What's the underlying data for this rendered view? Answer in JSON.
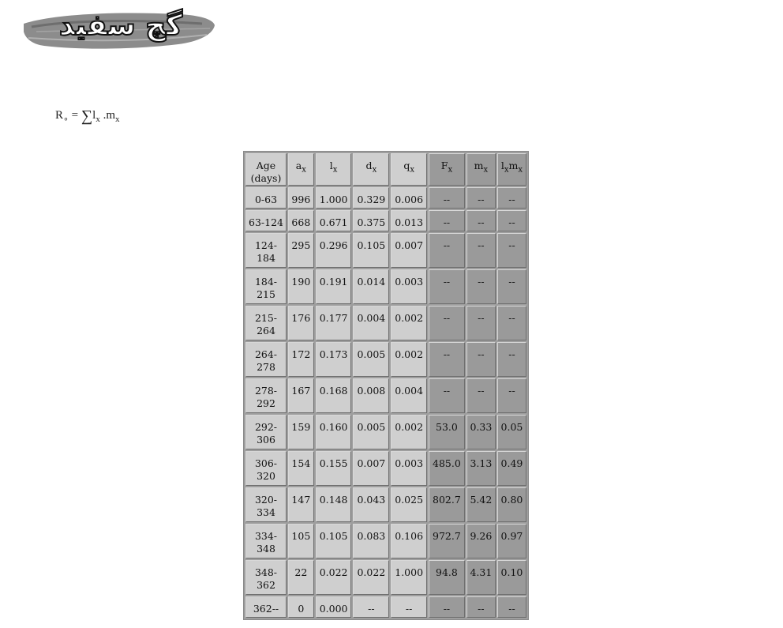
{
  "logo": {
    "text": "گچ سفید"
  },
  "formula": {
    "lhs": "R",
    "lhs_sub": "∘",
    "equals": "=",
    "sigma": "∑",
    "term1": "l",
    "term1_sub": "x",
    "dot": ".",
    "term2": "m",
    "term2_sub": "x"
  },
  "table": {
    "headers": [
      {
        "label": "Age (days)",
        "sub": ""
      },
      {
        "label": "a",
        "sub": "x"
      },
      {
        "label": "l",
        "sub": "x"
      },
      {
        "label": "d",
        "sub": "x"
      },
      {
        "label": "q",
        "sub": "x"
      },
      {
        "label": "F",
        "sub": "x"
      },
      {
        "label": "m",
        "sub": "x"
      },
      {
        "label": "l",
        "sub": "x",
        "label2": "m",
        "sub2": "x"
      }
    ],
    "rows": [
      [
        "0-63",
        "996",
        "1.000",
        "0.329",
        "0.006",
        "--",
        "--",
        "--"
      ],
      [
        "63-124",
        "668",
        "0.671",
        "0.375",
        "0.013",
        "--",
        "--",
        "--"
      ],
      [
        "124-184",
        "295",
        "0.296",
        "0.105",
        "0.007",
        "--",
        "--",
        "--"
      ],
      [
        "184-215",
        "190",
        "0.191",
        "0.014",
        "0.003",
        "--",
        "--",
        "--"
      ],
      [
        "215-264",
        "176",
        "0.177",
        "0.004",
        "0.002",
        "--",
        "--",
        "--"
      ],
      [
        "264-278",
        "172",
        "0.173",
        "0.005",
        "0.002",
        "--",
        "--",
        "--"
      ],
      [
        "278-292",
        "167",
        "0.168",
        "0.008",
        "0.004",
        "--",
        "--",
        "--"
      ],
      [
        "292-306",
        "159",
        "0.160",
        "0.005",
        "0.002",
        "53.0",
        "0.33",
        "0.05"
      ],
      [
        "306-320",
        "154",
        "0.155",
        "0.007",
        "0.003",
        "485.0",
        "3.13",
        "0.49"
      ],
      [
        "320-334",
        "147",
        "0.148",
        "0.043",
        "0.025",
        "802.7",
        "5.42",
        "0.80"
      ],
      [
        "334-348",
        "105",
        "0.105",
        "0.083",
        "0.106",
        "972.7",
        "9.26",
        "0.97"
      ],
      [
        "348-362",
        "22",
        "0.022",
        "0.022",
        "1.000",
        "94.8",
        "4.31",
        "0.10"
      ],
      [
        "362--",
        "0",
        "0.000",
        "--",
        "--",
        "--",
        "--",
        "--"
      ]
    ]
  }
}
